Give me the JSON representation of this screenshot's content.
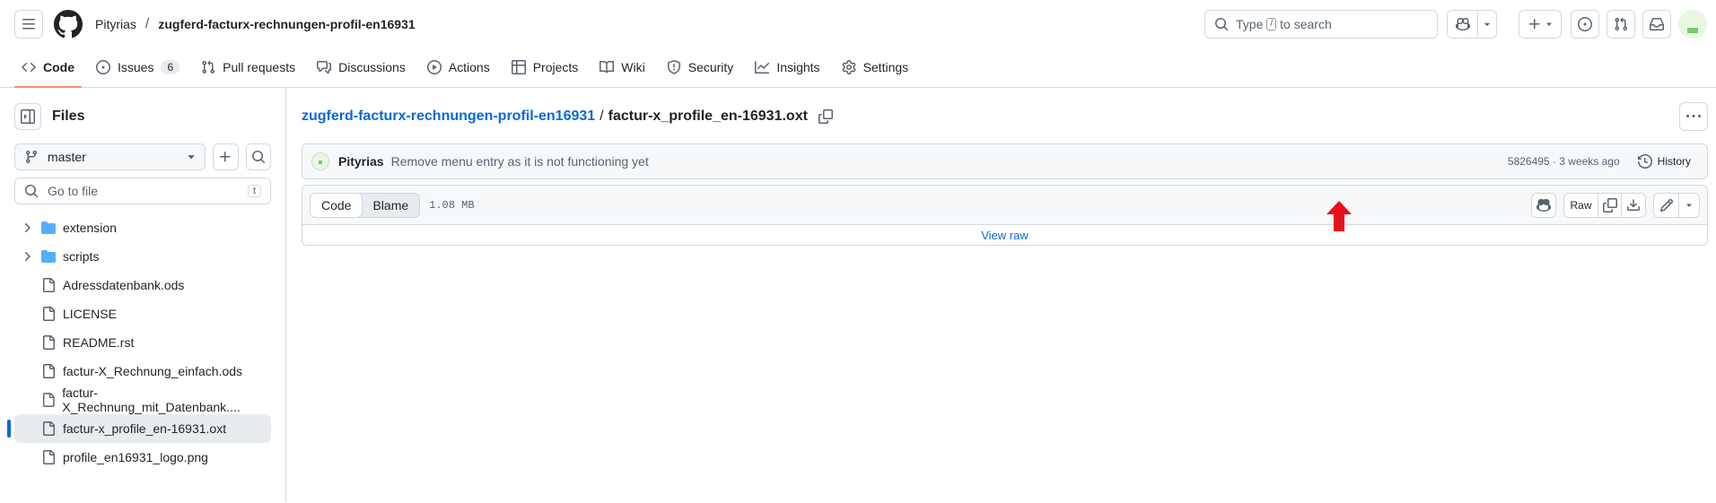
{
  "header": {
    "owner": "Pityrias",
    "separator": "/",
    "repo": "zugferd-facturx-rechnungen-profil-en16931",
    "search": {
      "prefix": "Type",
      "key": "/",
      "suffix": "to search"
    }
  },
  "repo_nav": {
    "tabs": [
      {
        "label": "Code",
        "icon": "code-icon"
      },
      {
        "label": "Issues",
        "icon": "issue-opened-icon",
        "count": "6"
      },
      {
        "label": "Pull requests",
        "icon": "git-pull-request-icon"
      },
      {
        "label": "Discussions",
        "icon": "comment-discussion-icon"
      },
      {
        "label": "Actions",
        "icon": "play-icon"
      },
      {
        "label": "Projects",
        "icon": "table-icon"
      },
      {
        "label": "Wiki",
        "icon": "book-icon"
      },
      {
        "label": "Security",
        "icon": "shield-icon"
      },
      {
        "label": "Insights",
        "icon": "graph-icon"
      },
      {
        "label": "Settings",
        "icon": "gear-icon"
      }
    ]
  },
  "sidebar": {
    "title": "Files",
    "branch": "master",
    "goto_placeholder": "Go to file",
    "goto_key": "t",
    "items": [
      {
        "name": "extension",
        "type": "folder"
      },
      {
        "name": "scripts",
        "type": "folder"
      },
      {
        "name": "Adressdatenbank.ods",
        "type": "file"
      },
      {
        "name": "LICENSE",
        "type": "file"
      },
      {
        "name": "README.rst",
        "type": "file"
      },
      {
        "name": "factur-X_Rechnung_einfach.ods",
        "type": "file"
      },
      {
        "name": "factur-X_Rechnung_mit_Datenbank....",
        "type": "file"
      },
      {
        "name": "factur-x_profile_en-16931.oxt",
        "type": "file",
        "selected": true
      },
      {
        "name": "profile_en16931_logo.png",
        "type": "file"
      }
    ]
  },
  "main": {
    "path_repo": "zugferd-facturx-rechnungen-profil-en16931",
    "path_sep": "/",
    "path_file": "factur-x_profile_en-16931.oxt",
    "commit": {
      "author": "Pityrias",
      "message": "Remove menu entry as it is not functioning yet",
      "meta": "5826495 · 3 weeks ago",
      "history_label": "History"
    },
    "file": {
      "tab_code": "Code",
      "tab_blame": "Blame",
      "size": "1.08 MB",
      "raw_label": "Raw",
      "view_raw": "View raw"
    }
  },
  "colors": {
    "accent_link": "#0969da",
    "active_tab_underline": "#fd8c73",
    "annotation_arrow": "#e8101a",
    "folder": "#54aeff"
  }
}
